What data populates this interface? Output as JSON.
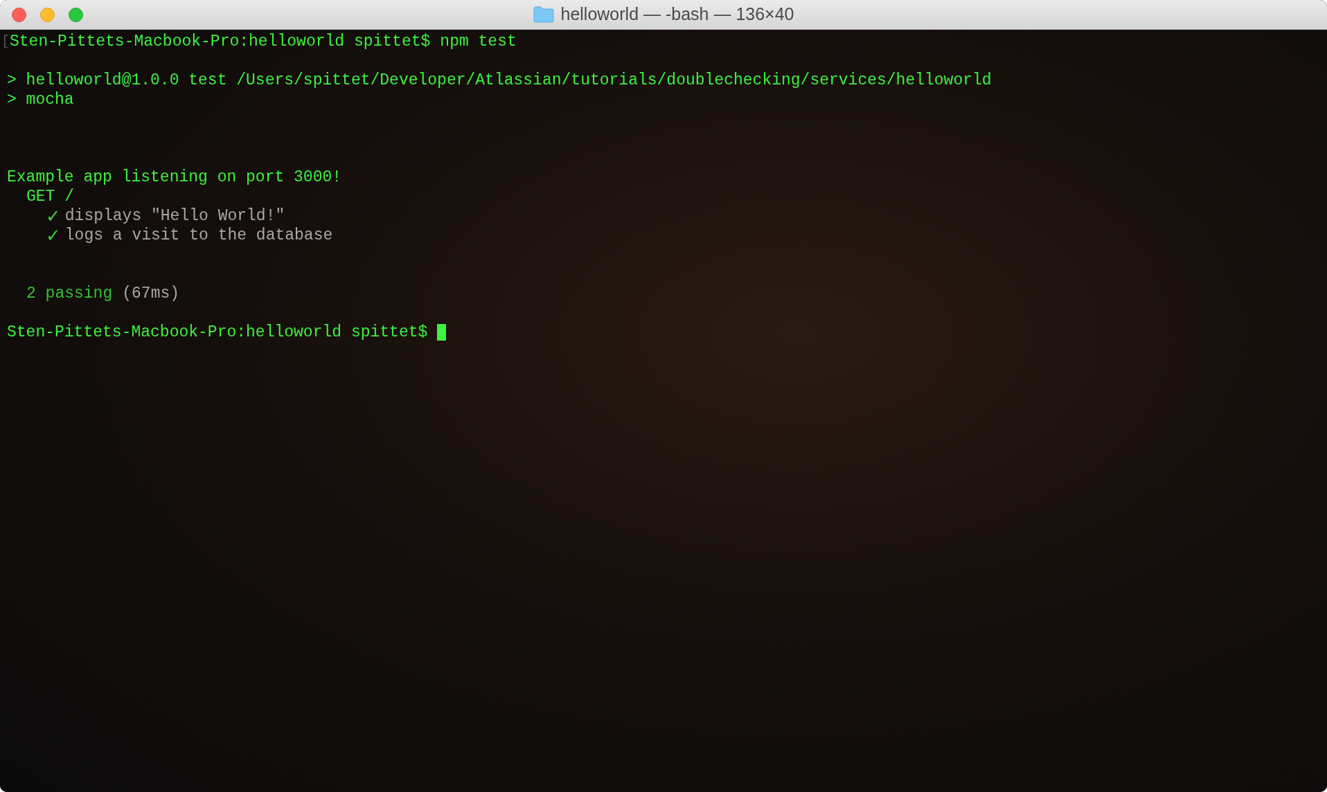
{
  "window": {
    "title": "helloworld — -bash — 136×40"
  },
  "terminal": {
    "lines": [
      {
        "kind": "prompt",
        "marker": "[",
        "prompt": "Sten-Pittets-Macbook-Pro:helloworld spittet$",
        "command": "npm test",
        "cursor": false
      },
      {
        "kind": "blank"
      },
      {
        "kind": "output",
        "text": "> helloworld@1.0.0 test /Users/spittet/Developer/Atlassian/tutorials/doublechecking/services/helloworld"
      },
      {
        "kind": "output",
        "text": "> mocha"
      },
      {
        "kind": "blank"
      },
      {
        "kind": "blank"
      },
      {
        "kind": "blank"
      },
      {
        "kind": "output",
        "text": "Example app listening on port 3000!"
      },
      {
        "kind": "suite",
        "text": "GET /"
      },
      {
        "kind": "test",
        "mark": "✓",
        "text": "displays \"Hello World!\""
      },
      {
        "kind": "test",
        "mark": "✓",
        "text": "logs a visit to the database"
      },
      {
        "kind": "blank"
      },
      {
        "kind": "blank"
      },
      {
        "kind": "summary",
        "text": "2 passing",
        "detail": "(67ms)"
      },
      {
        "kind": "blank"
      },
      {
        "kind": "prompt",
        "prompt": "Sten-Pittets-Macbook-Pro:helloworld spittet$",
        "cursor": true
      }
    ]
  }
}
